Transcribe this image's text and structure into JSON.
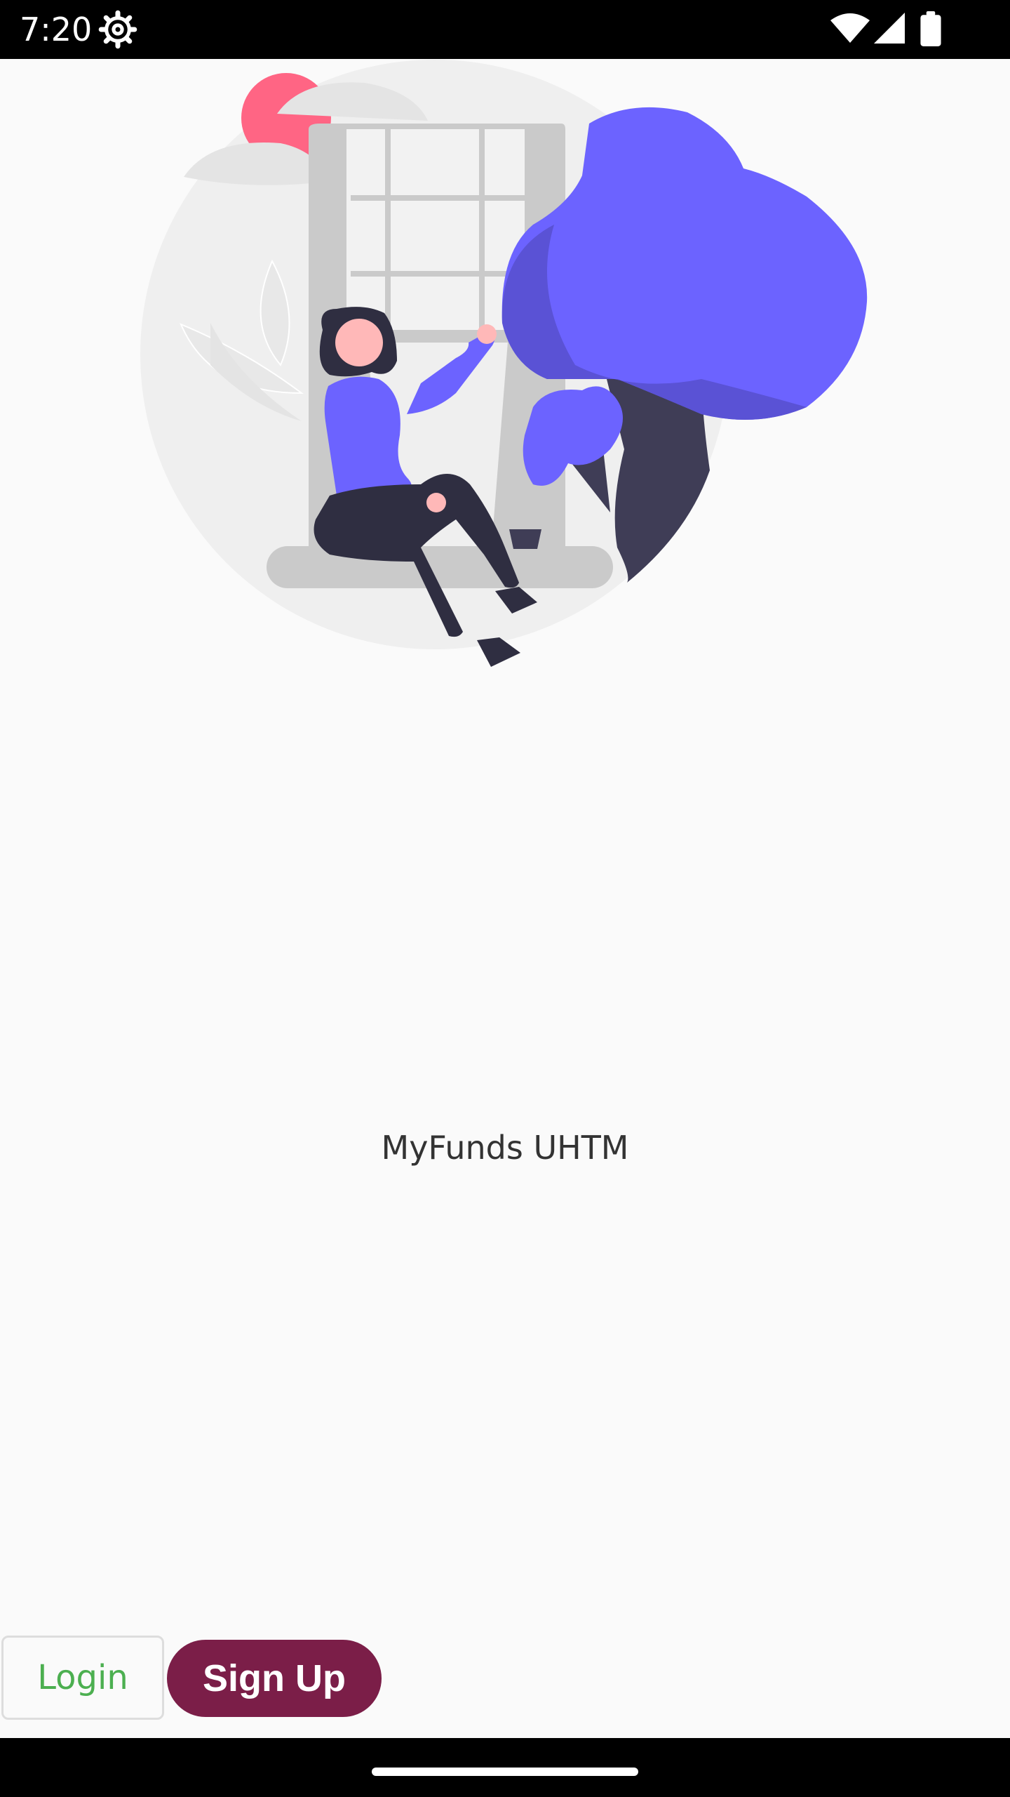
{
  "status_bar": {
    "time": "7:20",
    "icons": [
      "settings-gear-icon",
      "wifi-icon",
      "cell-signal-icon",
      "battery-icon"
    ]
  },
  "hero": {
    "illustration": "woman-sitting-by-window-with-tree-illustration",
    "colors": {
      "accent": "#6C63FF",
      "dark": "#3F3D56",
      "sun": "#FF6584",
      "background_circle": "#EFEFEF"
    }
  },
  "app": {
    "name": "MyFunds UHTM"
  },
  "actions": {
    "login_label": "Login",
    "signup_label": "Sign Up"
  },
  "colors": {
    "login_text": "#4CAF50",
    "signup_bg": "#7B1E48",
    "page_bg": "#FAFAFA"
  }
}
